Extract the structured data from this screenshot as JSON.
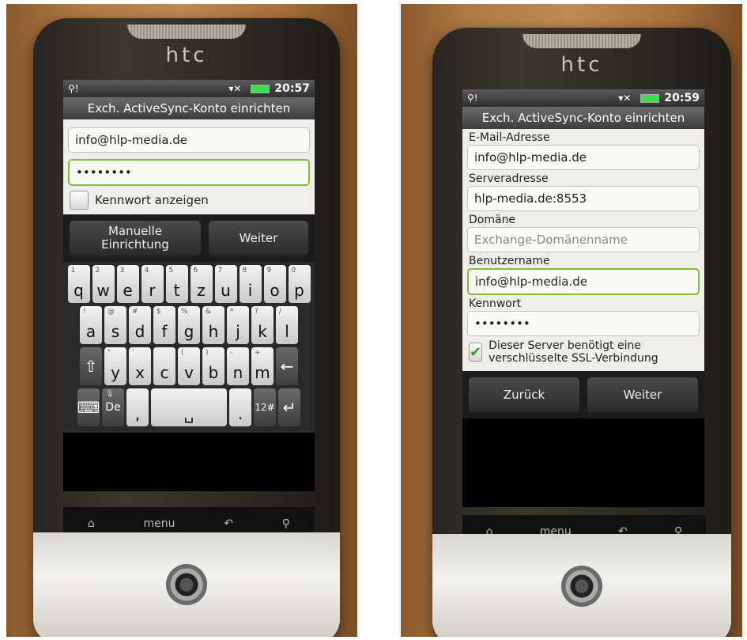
{
  "brand": "htc",
  "left": {
    "status": {
      "time": "20:57"
    },
    "title": "Exch. ActiveSync-Konto einrichten",
    "email_value": "info@hlp-media.de",
    "password_value": "••••••••",
    "show_password_label": "Kennwort anzeigen",
    "buttons": {
      "manual": "Manuelle Einrichtung",
      "next": "Weiter"
    },
    "keyboard": {
      "row1": [
        {
          "k": "q",
          "s": "1"
        },
        {
          "k": "w",
          "s": "2"
        },
        {
          "k": "e",
          "s": "3"
        },
        {
          "k": "r",
          "s": "4"
        },
        {
          "k": "t",
          "s": "5"
        },
        {
          "k": "z",
          "s": "6"
        },
        {
          "k": "u",
          "s": "7"
        },
        {
          "k": "i",
          "s": "8"
        },
        {
          "k": "o",
          "s": "9"
        },
        {
          "k": "p",
          "s": "0"
        }
      ],
      "row2": [
        {
          "k": "a",
          "s": "!"
        },
        {
          "k": "s",
          "s": "@"
        },
        {
          "k": "d",
          "s": "#"
        },
        {
          "k": "f",
          "s": "$"
        },
        {
          "k": "g",
          "s": "%"
        },
        {
          "k": "h",
          "s": "&"
        },
        {
          "k": "j",
          "s": "*"
        },
        {
          "k": "k",
          "s": "?"
        },
        {
          "k": "l",
          "s": "/"
        }
      ],
      "row3": [
        {
          "k": "y",
          "s": "\""
        },
        {
          "k": "x",
          "s": "'"
        },
        {
          "k": "c",
          "s": ""
        },
        {
          "k": "v",
          "s": "("
        },
        {
          "k": "b",
          "s": ")"
        },
        {
          "k": "n",
          "s": "-"
        },
        {
          "k": "m",
          "s": "+"
        }
      ],
      "lang": "De",
      "numsym": "12#"
    },
    "nav": {
      "menu": "menu"
    }
  },
  "right": {
    "status": {
      "time": "20:59"
    },
    "title": "Exch. ActiveSync-Konto einrichten",
    "fields": {
      "email_label": "E-Mail-Adresse",
      "email_value": "info@hlp-media.de",
      "server_label": "Serveradresse",
      "server_value": "hlp-media.de:8553",
      "domain_label": "Domäne",
      "domain_placeholder": "Exchange-Domänenname",
      "username_label": "Benutzername",
      "username_value": "info@hlp-media.de",
      "password_label": "Kennwort",
      "password_value": "••••••••"
    },
    "ssl_label": "Dieser Server benötigt eine verschlüsselte SSL-Verbindung",
    "buttons": {
      "back": "Zurück",
      "next": "Weiter"
    },
    "nav": {
      "menu": "menu"
    }
  }
}
